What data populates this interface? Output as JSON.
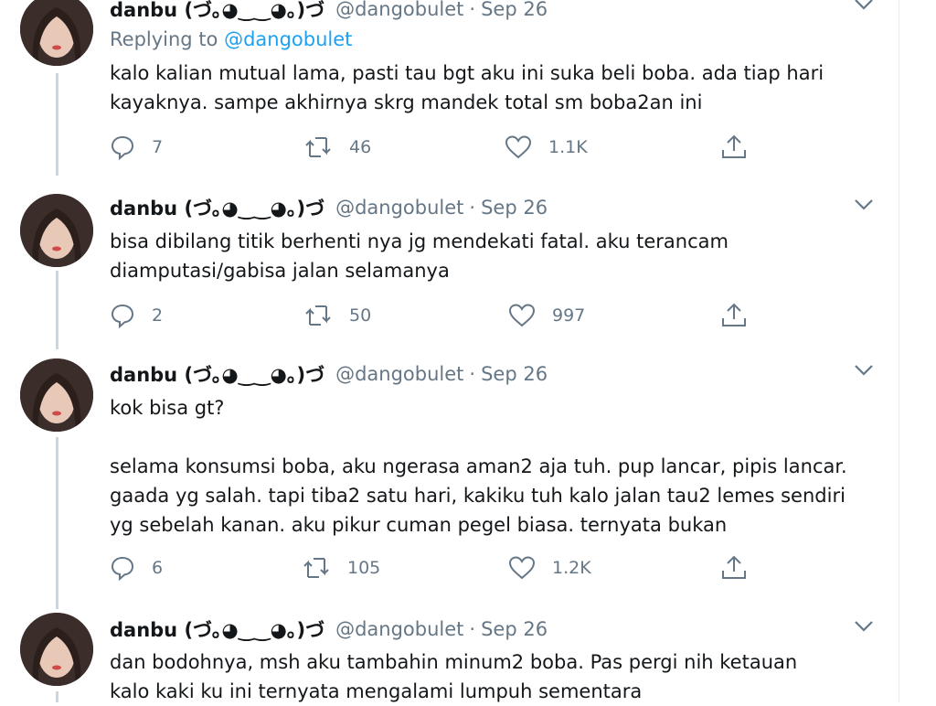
{
  "colors": {
    "accent": "#1da1f2",
    "muted": "#657786",
    "text": "#14171a",
    "thread_line": "#ccd6dd"
  },
  "tweets": [
    {
      "name": "danbu (づ｡◕‿‿◕｡)づ",
      "handle": "@dangobulet",
      "separator": "·",
      "date": "Sep 26",
      "reply_label": "Replying to",
      "reply_mention": "@dangobulet",
      "lines": [
        "kalo kalian mutual lama, pasti tau bgt aku ini suka beli boba. ada tiap hari",
        "kayaknya. sampe akhirnya skrg mandek total sm boba2an ini"
      ],
      "replies": "7",
      "retweets": "46",
      "likes": "1.1K"
    },
    {
      "name": "danbu (づ｡◕‿‿◕｡)づ",
      "handle": "@dangobulet",
      "separator": "·",
      "date": "Sep 26",
      "lines": [
        "bisa dibilang titik berhenti nya jg mendekati fatal. aku terancam",
        "diamputasi/gabisa jalan selamanya"
      ],
      "replies": "2",
      "retweets": "50",
      "likes": "997"
    },
    {
      "name": "danbu (づ｡◕‿‿◕｡)づ",
      "handle": "@dangobulet",
      "separator": "·",
      "date": "Sep 26",
      "lines": [
        "kok bisa gt?",
        "",
        "selama konsumsi boba, aku ngerasa aman2 aja tuh. pup lancar, pipis lancar.",
        "gaada yg salah. tapi tiba2 satu hari, kakiku tuh kalo jalan tau2 lemes sendiri",
        "yg sebelah kanan. aku pikur cuman pegel biasa. ternyata bukan"
      ],
      "replies": "6",
      "retweets": "105",
      "likes": "1.2K"
    },
    {
      "name": "danbu (づ｡◕‿‿◕｡)づ",
      "handle": "@dangobulet",
      "separator": "·",
      "date": "Sep 26",
      "lines": [
        "dan bodohnya, msh aku tambahin minum2 boba. Pas pergi nih ketauan",
        "kalo kaki ku ini ternyata mengalami lumpuh sementara"
      ]
    }
  ],
  "icons": {
    "reply": "reply-bubble-icon",
    "retweet": "retweet-arrows-icon",
    "like": "heart-icon",
    "share": "share-upload-icon",
    "caret": "chevron-down-icon"
  }
}
